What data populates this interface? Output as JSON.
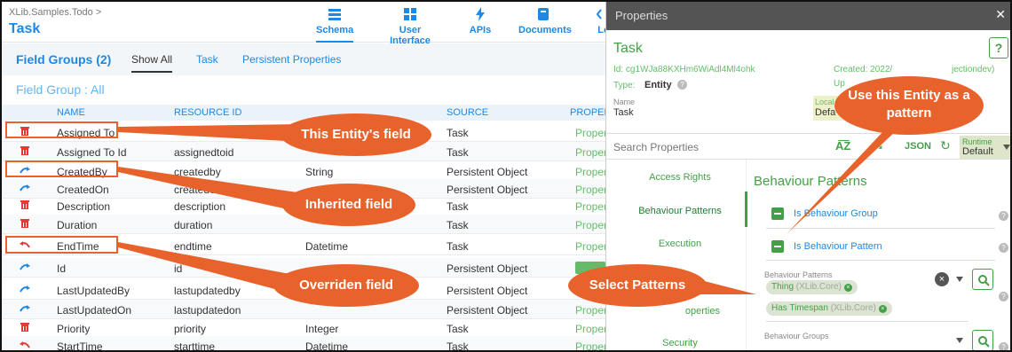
{
  "app": {
    "breadcrumb": "XLib.Samples.Todo >",
    "title": "Task",
    "nav": [
      {
        "label": "Schema",
        "icon": "schema-icon",
        "active": true
      },
      {
        "label": "User Interface",
        "icon": "grid-icon",
        "active": false
      },
      {
        "label": "APIs",
        "icon": "lightning-icon",
        "active": false
      },
      {
        "label": "Documents",
        "icon": "document-icon",
        "active": false
      },
      {
        "label": "Lo",
        "icon": "code-icon",
        "active": false
      }
    ],
    "field_groups_title": "Field Groups (2)",
    "tabs": [
      "Show All",
      "Task",
      "Persistent Properties"
    ],
    "field_group_subtitle": "Field Group : All",
    "columns": [
      "NAME",
      "RESOURCE ID",
      "SOURCE",
      "PROPER"
    ],
    "rows": [
      {
        "icon": "delete-icon",
        "name": "Assigned To",
        "resource_id": "",
        "type": "",
        "source": "Task",
        "prop": "Proper"
      },
      {
        "icon": "delete-icon",
        "name": "Assigned To Id",
        "resource_id": "assignedtoid",
        "type": "",
        "source": "Task",
        "prop": "Proper"
      },
      {
        "icon": "inherit-icon",
        "name": "CreatedBy",
        "resource_id": "createdby",
        "type": "String",
        "source": "Persistent Object",
        "prop": "Proper"
      },
      {
        "icon": "inherit-icon",
        "name": "CreatedOn",
        "resource_id": "createdo",
        "type": "",
        "source": "Persistent Object",
        "prop": "Proper"
      },
      {
        "icon": "delete-icon",
        "name": "Description",
        "resource_id": "description",
        "type": "",
        "source": "Task",
        "prop": "Proper"
      },
      {
        "icon": "delete-icon",
        "name": "Duration",
        "resource_id": "duration",
        "type": "",
        "source": "Task",
        "prop": "Proper"
      },
      {
        "icon": "override-icon",
        "name": "EndTime",
        "resource_id": "endtime",
        "type": "Datetime",
        "source": "Task",
        "prop": "Proper"
      },
      {
        "icon": "inherit-icon",
        "name": "Id",
        "resource_id": "id",
        "type": "",
        "source": "Persistent Object",
        "prop": ""
      },
      {
        "icon": "inherit-icon",
        "name": "LastUpdatedBy",
        "resource_id": "lastupdatedby",
        "type": "",
        "source": "Persistent Object",
        "prop": "Proper"
      },
      {
        "icon": "inherit-icon",
        "name": "LastUpdatedOn",
        "resource_id": "lastupdatedon",
        "type": "",
        "source": "Persistent Object",
        "prop": "Proper"
      },
      {
        "icon": "delete-icon",
        "name": "Priority",
        "resource_id": "priority",
        "type": "Integer",
        "source": "Task",
        "prop": "Proper"
      },
      {
        "icon": "override-icon",
        "name": "StartTime",
        "resource_id": "starttime",
        "type": "Datetime",
        "source": "Task",
        "prop": "Proper"
      }
    ]
  },
  "panel": {
    "header": "Properties",
    "entity_title": "Task",
    "help": "?",
    "id_text": "Id: cg1WJa88KXHm6WiAdl4Ml4ohk",
    "created_text": "Created: 2022/",
    "created_suffix": "jectiondev)",
    "updated_text": "Up",
    "type_label": "Type:",
    "type_value": "Entity",
    "name_label": "Name",
    "name_value": "Task",
    "local_label": "Local",
    "local_value": "Defa",
    "search_placeholder": "Search Properties",
    "json_label": "JSON",
    "runtime_label": "Runtime",
    "runtime_value": "Default",
    "left_nav": [
      "Access Rights",
      "Behaviour Patterns",
      "Execution",
      "operties",
      "Security"
    ],
    "bp_title": "Behaviour Patterns",
    "is_group": "Is Behaviour Group",
    "is_pattern": "Is Behaviour Pattern",
    "bp_field_label": "Behaviour Patterns",
    "chips": [
      {
        "name": "Thing",
        "sub": "(XLib.Core)"
      },
      {
        "name": "Has Timespan",
        "sub": "(XLib.Core)"
      }
    ],
    "bg_field_label": "Behaviour Groups"
  },
  "callouts": {
    "c1": "This Entity's field",
    "c2": "Inherited field",
    "c3": "Overriden field",
    "c4": "Select Patterns",
    "c5a": "Use this Entity as a",
    "c5b": "pattern"
  },
  "colors": {
    "accent": "#1e88e5",
    "green": "#43a047",
    "callout": "#e8622c"
  }
}
